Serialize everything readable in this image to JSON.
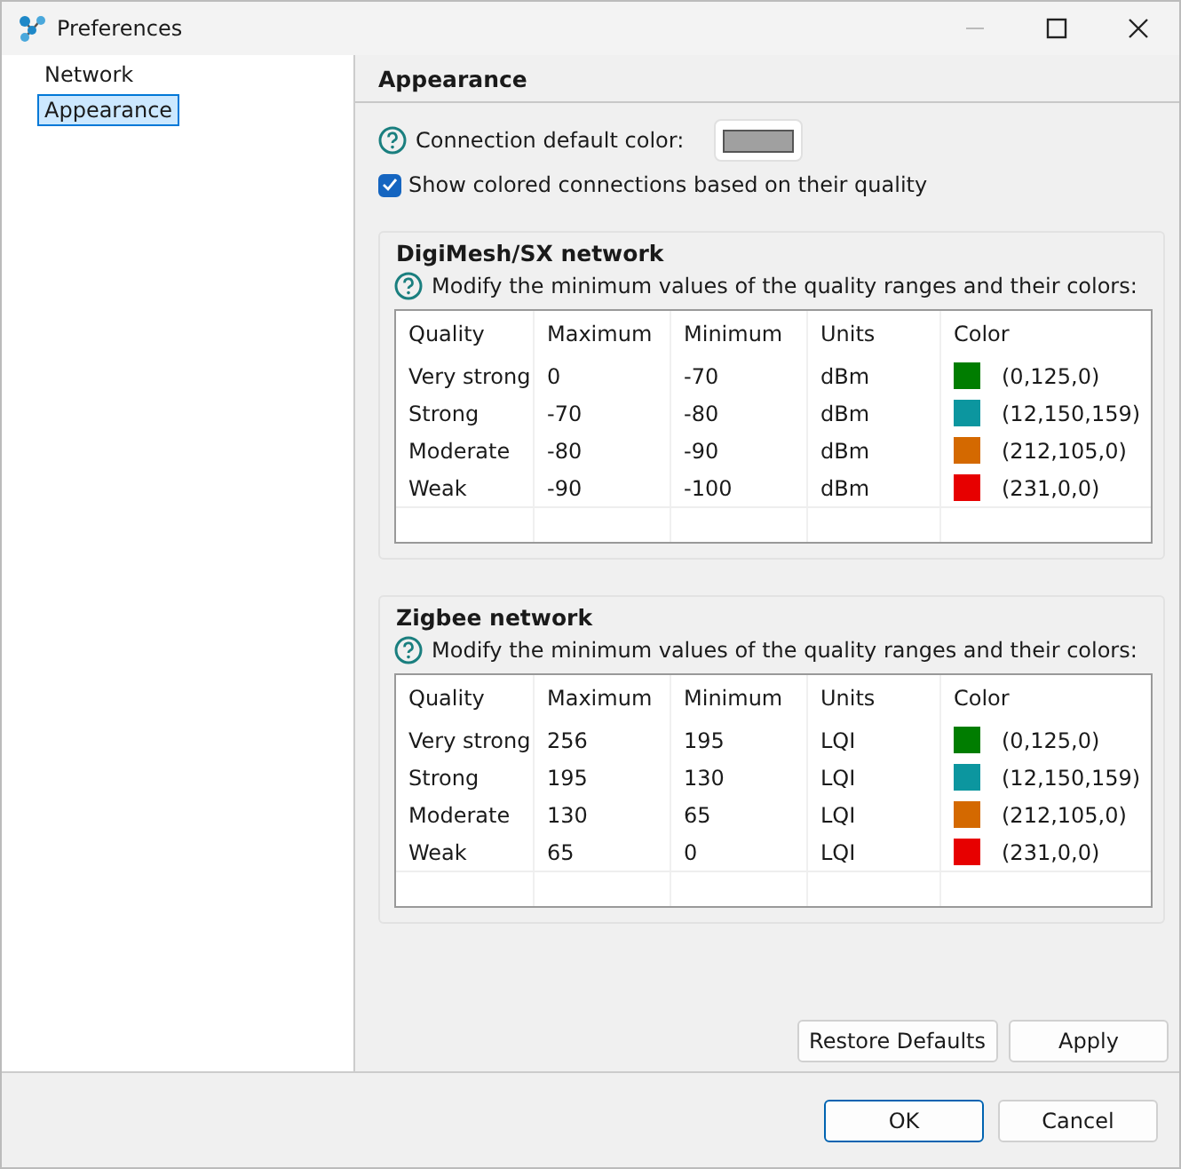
{
  "window": {
    "title": "Preferences"
  },
  "sidebar": {
    "items": [
      {
        "label": "Network",
        "selected": false
      },
      {
        "label": "Appearance",
        "selected": true
      }
    ]
  },
  "page": {
    "title": "Appearance",
    "default_color_label": "Connection default color:",
    "show_colored": {
      "label": "Show colored connections based on their quality",
      "checked": true
    }
  },
  "groups": [
    {
      "title": "DigiMesh/SX network",
      "hint": "Modify the minimum values of the quality ranges and their colors:",
      "columns": [
        "Quality",
        "Maximum",
        "Minimum",
        "Units",
        "Color"
      ],
      "rows": [
        {
          "quality": "Very strong",
          "maximum": "0",
          "minimum": "-70",
          "units": "dBm",
          "color": "#007d00",
          "color_text": "(0,125,0)"
        },
        {
          "quality": "Strong",
          "maximum": "-70",
          "minimum": "-80",
          "units": "dBm",
          "color": "#0c969f",
          "color_text": "(12,150,159)"
        },
        {
          "quality": "Moderate",
          "maximum": "-80",
          "minimum": "-90",
          "units": "dBm",
          "color": "#d46900",
          "color_text": "(212,105,0)"
        },
        {
          "quality": "Weak",
          "maximum": "-90",
          "minimum": "-100",
          "units": "dBm",
          "color": "#e70000",
          "color_text": "(231,0,0)"
        }
      ]
    },
    {
      "title": "Zigbee network",
      "hint": "Modify the minimum values of the quality ranges and their colors:",
      "columns": [
        "Quality",
        "Maximum",
        "Minimum",
        "Units",
        "Color"
      ],
      "rows": [
        {
          "quality": "Very strong",
          "maximum": "256",
          "minimum": "195",
          "units": "LQI",
          "color": "#007d00",
          "color_text": "(0,125,0)"
        },
        {
          "quality": "Strong",
          "maximum": "195",
          "minimum": "130",
          "units": "LQI",
          "color": "#0c969f",
          "color_text": "(12,150,159)"
        },
        {
          "quality": "Moderate",
          "maximum": "130",
          "minimum": "65",
          "units": "LQI",
          "color": "#d46900",
          "color_text": "(212,105,0)"
        },
        {
          "quality": "Weak",
          "maximum": "65",
          "minimum": "0",
          "units": "LQI",
          "color": "#e70000",
          "color_text": "(231,0,0)"
        }
      ]
    }
  ],
  "page_buttons": [
    "Restore Defaults",
    "Apply"
  ],
  "dialog_buttons": [
    {
      "label": "OK",
      "kind": "default"
    },
    {
      "label": "Cancel",
      "kind": "normal"
    }
  ]
}
